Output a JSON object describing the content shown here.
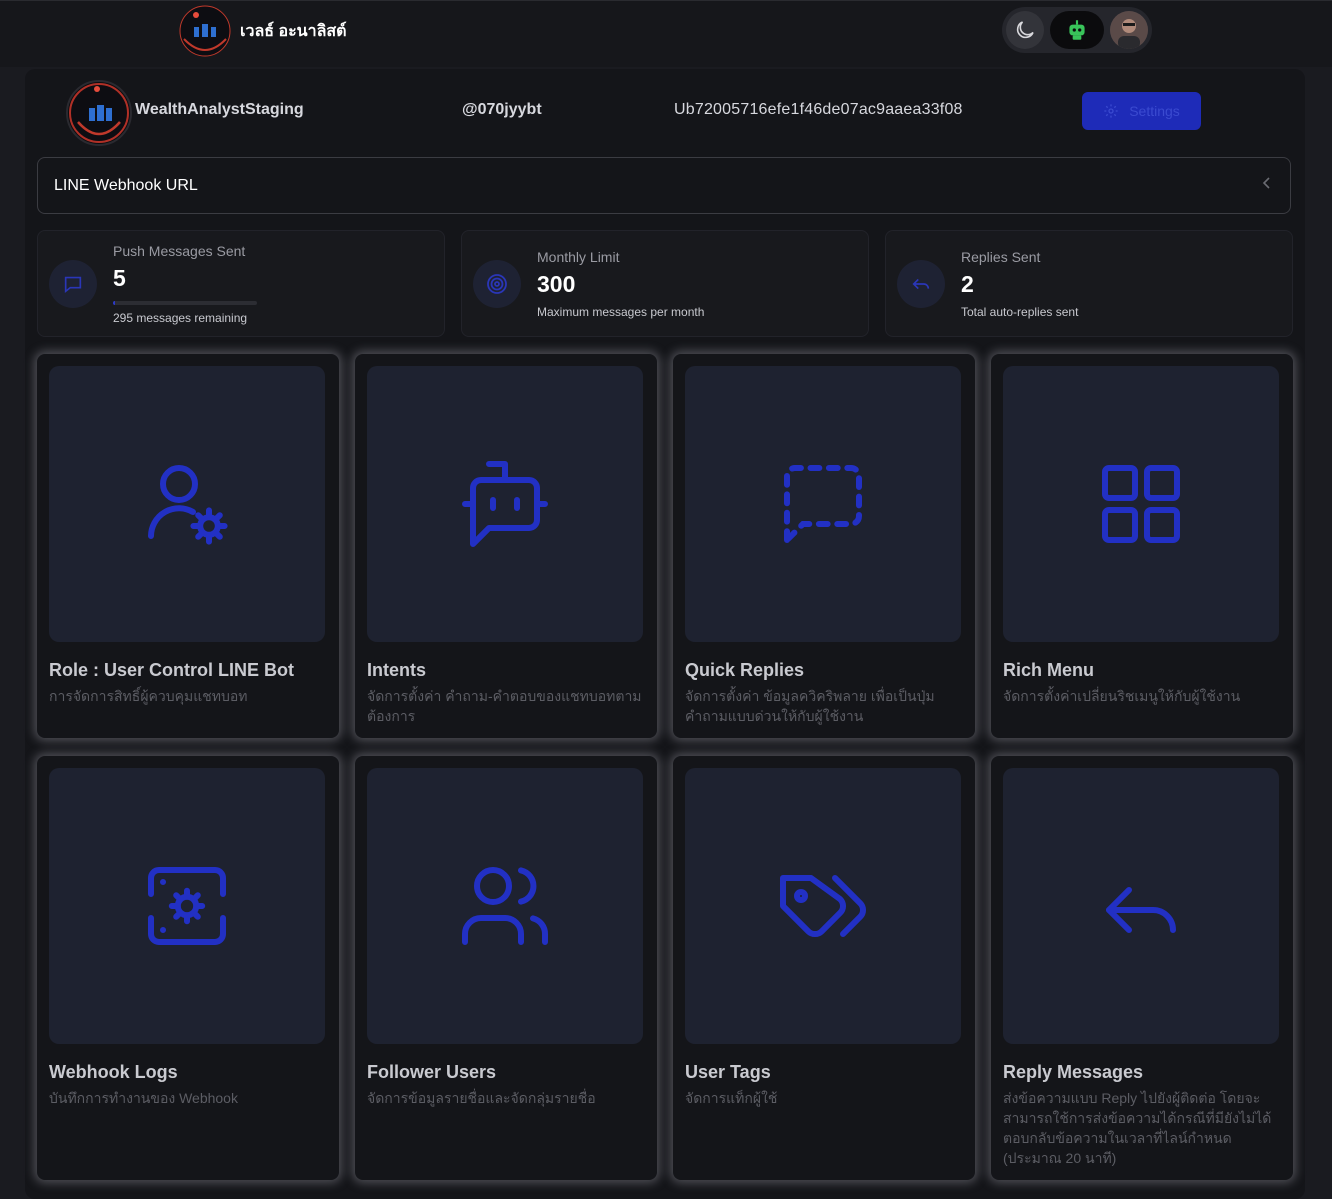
{
  "topbar": {
    "brand_name": "เวลธ์ อะนาลิสต์",
    "logo_text": "Wealth Analyst"
  },
  "header": {
    "bot_name": "WealthAnalystStaging",
    "bot_basic_id": "@070jyybt",
    "user_id": "Ub72005716efe1f46de07ac9aaea33f08",
    "settings_label": "Settings"
  },
  "webhook": {
    "label": "LINE Webhook URL"
  },
  "stats": [
    {
      "label": "Push Messages Sent",
      "value": "5",
      "sub": "295 messages remaining",
      "progress_fraction": 0.017
    },
    {
      "label": "Monthly Limit",
      "value": "300",
      "sub": "Maximum messages per month"
    },
    {
      "label": "Replies Sent",
      "value": "2",
      "sub": "Total auto-replies sent"
    }
  ],
  "cards": [
    {
      "title": "Role : User Control LINE Bot",
      "desc": "การจัดการสิทธิ์ผู้ควบคุมแชทบอท",
      "icon": "user-settings-icon"
    },
    {
      "title": "Intents",
      "desc": "จัดการตั้งค่า คำถาม-คำตอบของแชทบอทตามต้องการ",
      "icon": "bot-message-icon"
    },
    {
      "title": "Quick Replies",
      "desc": "จัดการตั้งค่า ข้อมูลควิคริพลาย เพื่อเป็นปุ่มคำถามแบบด่วนให้กับผู้ใช้งาน",
      "icon": "dashed-message-icon"
    },
    {
      "title": "Rich Menu",
      "desc": "จัดการตั้งค่าเปลี่ยนริชเมนูให้กับผู้ใช้งาน",
      "icon": "grid-icon"
    },
    {
      "title": "Webhook Logs",
      "desc": "บันทึกการทำงานของ Webhook",
      "icon": "server-cog-icon"
    },
    {
      "title": "Follower Users",
      "desc": "จัดการข้อมูลรายชื่อและจัดกลุ่มรายชื่อ",
      "icon": "users-icon"
    },
    {
      "title": "User Tags",
      "desc": "จัดการแท็กผู้ใช้",
      "icon": "tags-icon"
    },
    {
      "title": "Reply Messages",
      "desc": "ส่งข้อความแบบ Reply ไปยังผู้ติดต่อ โดยจะสามารถใช้การส่งข้อความได้กรณีที่มียังไม่ได้ตอบกลับข้อความในเวลาที่ไลน์กำหนด (ประมาณ 20 นาที)",
      "icon": "reply-icon"
    }
  ],
  "colors": {
    "accent": "#2230c4",
    "background": "#141519",
    "card_image": "#1e2230"
  }
}
